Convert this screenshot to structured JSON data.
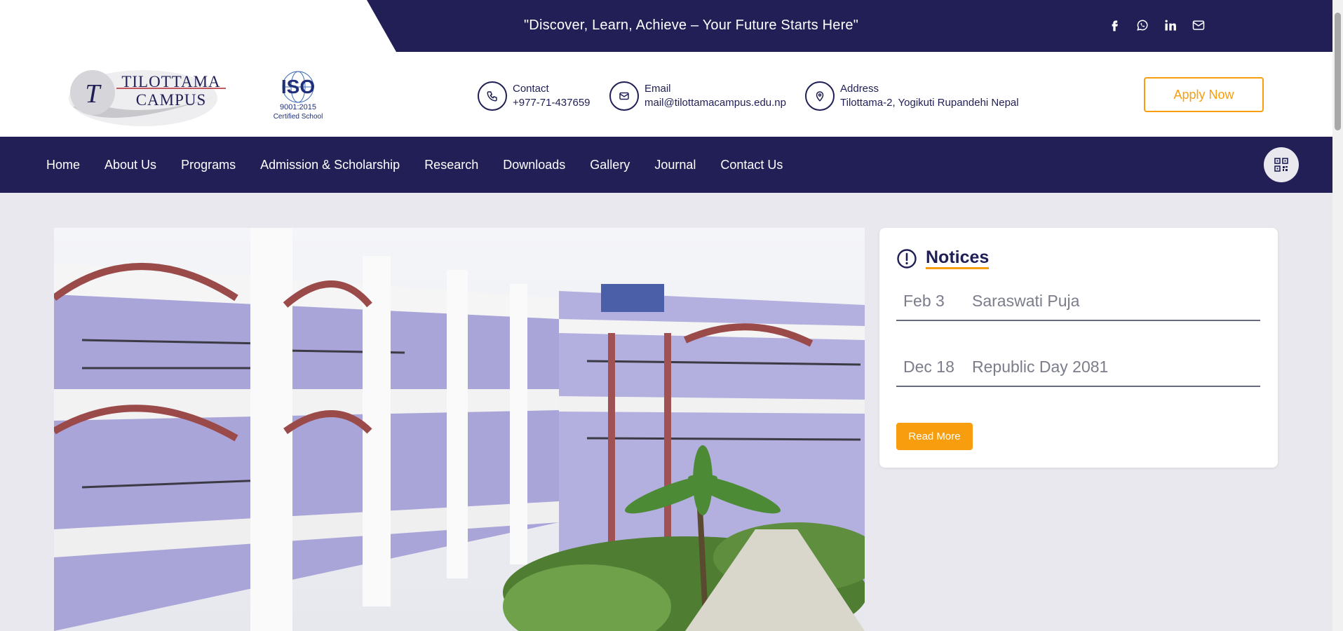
{
  "topbar": {
    "tagline": "\"Discover, Learn, Achieve – Your Future Starts Here\"",
    "social_icons": [
      "facebook-icon",
      "whatsapp-icon",
      "linkedin-icon",
      "mail-icon"
    ]
  },
  "header": {
    "logo_text_line1": "TILOTTAMA",
    "logo_text_line2": "CAMPUS",
    "iso_text": "ISO",
    "iso_number": "9001:2015",
    "iso_caption": "Certified School",
    "contact_label": "Contact",
    "contact_value": "+977-71-437659",
    "email_label": "Email",
    "email_value": "mail@tilottamacampus.edu.np",
    "address_label": "Address",
    "address_value": "Tilottama-2, Yogikuti Rupandehi Nepal",
    "apply_label": "Apply Now"
  },
  "nav": {
    "items": [
      "Home",
      "About Us",
      "Programs",
      "Admission & Scholarship",
      "Research",
      "Downloads",
      "Gallery",
      "Journal",
      "Contact Us"
    ]
  },
  "notices": {
    "title": "Notices",
    "items": [
      {
        "date": "Feb 3",
        "title": "Saraswati Puja"
      },
      {
        "date": "Dec 18",
        "title": "Republic Day 2081"
      }
    ],
    "read_more": "Read More"
  },
  "colors": {
    "navy": "#221f57",
    "accent": "#f79d0e",
    "page_bg": "#e9e8ee"
  }
}
